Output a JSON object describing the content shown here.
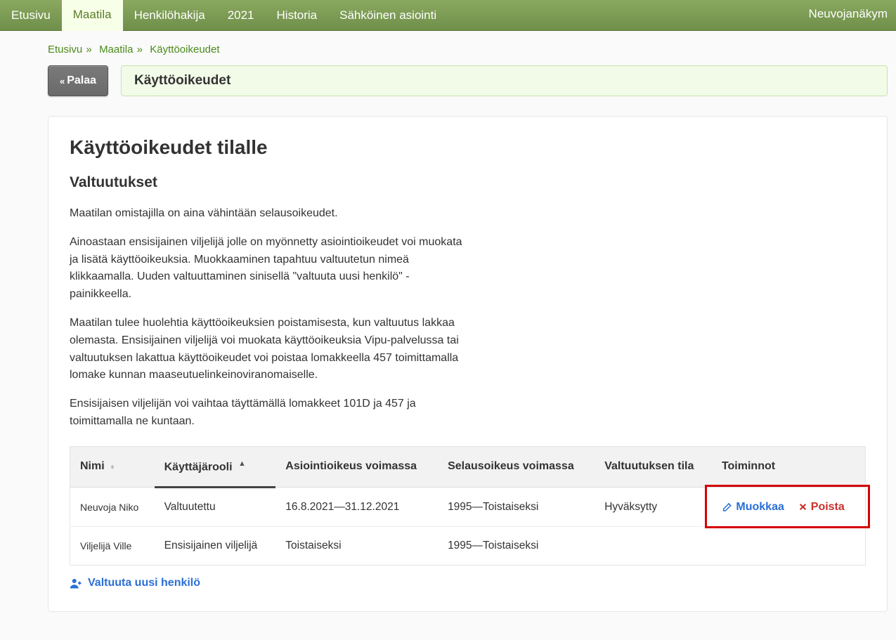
{
  "nav": {
    "items": [
      {
        "label": "Etusivu",
        "active": false
      },
      {
        "label": "Maatila",
        "active": true
      },
      {
        "label": "Henkilöhakija",
        "active": false
      },
      {
        "label": "2021",
        "active": false
      },
      {
        "label": "Historia",
        "active": false
      },
      {
        "label": "Sähköinen asiointi",
        "active": false
      }
    ],
    "right_label": "Neuvojanäkym"
  },
  "breadcrumbs": {
    "items": [
      {
        "label": "Etusivu",
        "link": true
      },
      {
        "label": "Maatila",
        "link": true
      },
      {
        "label": "Käyttöoikeudet",
        "link": true
      }
    ],
    "separator": "»"
  },
  "back_button": "Palaa",
  "page_title_bar": "Käyttöoikeudet",
  "section": {
    "h1": "Käyttöoikeudet tilalle",
    "h2": "Valtuutukset",
    "paragraphs": [
      "Maatilan omistajilla on aina vähintään selausoikeudet.",
      "Ainoastaan ensisijainen viljelijä jolle on myönnetty asiointioikeudet voi muokata ja lisätä käyttöoikeuksia. Muokkaaminen tapahtuu valtuutetun nimeä klikkaamalla. Uuden valtuuttaminen sinisellä \"valtuuta uusi henkilö\" -painikkeella.",
      "Maatilan tulee huolehtia käyttöoikeuksien poistamisesta, kun valtuutus lakkaa olemasta. Ensisijainen viljelijä voi muokata käyttöoikeuksia Vipu-palvelussa tai valtuutuksen lakattua käyttöoikeudet voi poistaa lomakkeella 457 toimittamalla lomake kunnan maaseutuelinkeinoviranomaiselle.",
      "Ensisijaisen viljelijän voi vaihtaa täyttämällä lomakkeet 101D ja 457 ja toimittamalla ne kuntaan."
    ]
  },
  "table": {
    "columns": [
      {
        "label": "Nimi",
        "sort": "both"
      },
      {
        "label": "Käyttäjärooli",
        "sort": "asc"
      },
      {
        "label": "Asiointioikeus voimassa",
        "sort": "none"
      },
      {
        "label": "Selausoikeus voimassa",
        "sort": "none"
      },
      {
        "label": "Valtuutuksen tila",
        "sort": "none"
      },
      {
        "label": "Toiminnot",
        "sort": "none"
      }
    ],
    "rows": [
      {
        "name": "Neuvoja Niko",
        "role": "Valtuutettu",
        "asiointi": "16.8.2021—31.12.2021",
        "selaus": "1995—Toistaiseksi",
        "tila": "Hyväksytty",
        "edit_label": "Muokkaa",
        "delete_label": "Poista",
        "show_actions": true
      },
      {
        "name": "Viljelijä Ville",
        "role": "Ensisijainen viljelijä",
        "asiointi": "Toistaiseksi",
        "selaus": "1995—Toistaiseksi",
        "tila": "",
        "show_actions": false
      }
    ]
  },
  "add_link": "Valtuuta uusi henkilö"
}
